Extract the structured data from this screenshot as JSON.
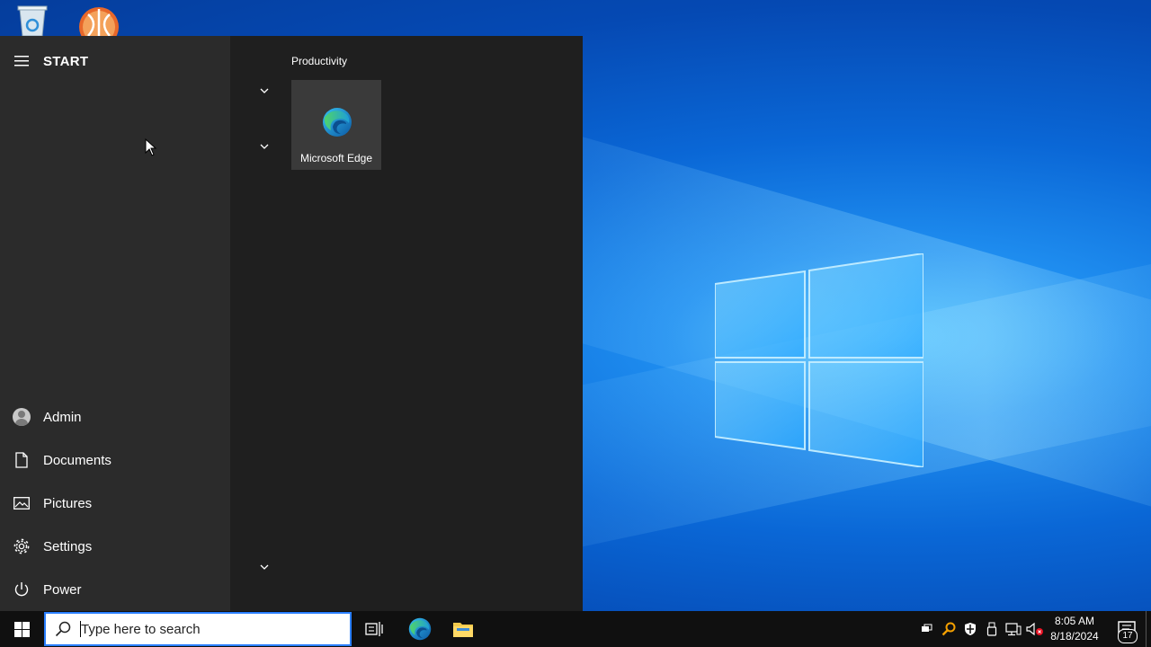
{
  "desktop": {
    "icons": [
      {
        "name": "recycle-bin-icon"
      },
      {
        "name": "app-shortcut-icon"
      }
    ]
  },
  "start_menu": {
    "title": "START",
    "side_items": [
      {
        "label": "Admin",
        "icon": "user-avatar-icon"
      },
      {
        "label": "Documents",
        "icon": "document-icon"
      },
      {
        "label": "Pictures",
        "icon": "pictures-icon"
      },
      {
        "label": "Settings",
        "icon": "gear-icon"
      },
      {
        "label": "Power",
        "icon": "power-icon"
      }
    ],
    "group_title": "Productivity",
    "tile_label": "Microsoft Edge"
  },
  "taskbar": {
    "search_placeholder": "Type here to search",
    "clock_time": "8:05 AM",
    "clock_date": "8/18/2024",
    "notification_count": "17"
  },
  "colors": {
    "start_bg": "#1f1f1f",
    "start_left_bg": "#2b2b2b",
    "tile_bg": "#3a3a3a",
    "taskbar_bg": "#101010",
    "search_border": "#2a7fff"
  }
}
